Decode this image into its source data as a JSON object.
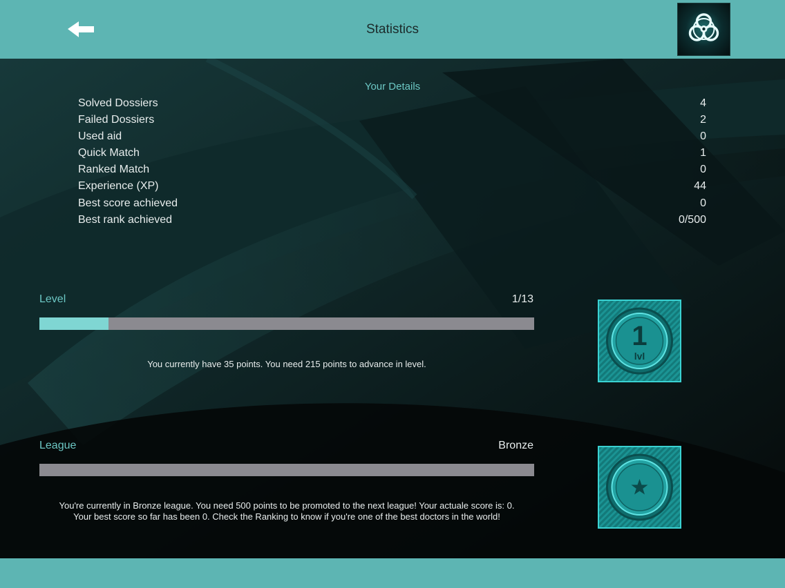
{
  "header": {
    "title": "Statistics",
    "back_icon": "back-arrow-icon",
    "logo_icon": "biohazard-icon"
  },
  "details": {
    "title": "Your Details",
    "rows": [
      {
        "label": "Solved Dossiers",
        "value": "4"
      },
      {
        "label": "Failed Dossiers",
        "value": "2"
      },
      {
        "label": "Used aid",
        "value": "0"
      },
      {
        "label": "Quick Match",
        "value": "1"
      },
      {
        "label": "Ranked Match",
        "value": "0"
      },
      {
        "label": "Experience (XP)",
        "value": "44"
      },
      {
        "label": "Best score achieved",
        "value": "0"
      },
      {
        "label": "Best rank achieved",
        "value": "0/500"
      }
    ]
  },
  "level": {
    "label": "Level",
    "value": "1/13",
    "progress_fraction": 0.14,
    "note": "You currently have 35 points. You need 215 points to advance in level.",
    "badge_number": "1",
    "badge_text": "lvl"
  },
  "league": {
    "label": "League",
    "value": "Bronze",
    "progress_fraction": 0,
    "note_line1": "You're currently in Bronze league. You need 500 points to be promoted to the next league! Your actuale score is: 0.",
    "note_line2": "Your best score so far has been 0. Check the Ranking to know if you're one of the best doctors in the world!",
    "badge_icon": "star-icon"
  },
  "colors": {
    "accent": "#5db5b3",
    "label_teal": "#6cc7c4",
    "bar_fill": "#7fd6d3",
    "bar_track": "#8b8a90",
    "badge": "#1b9494"
  }
}
